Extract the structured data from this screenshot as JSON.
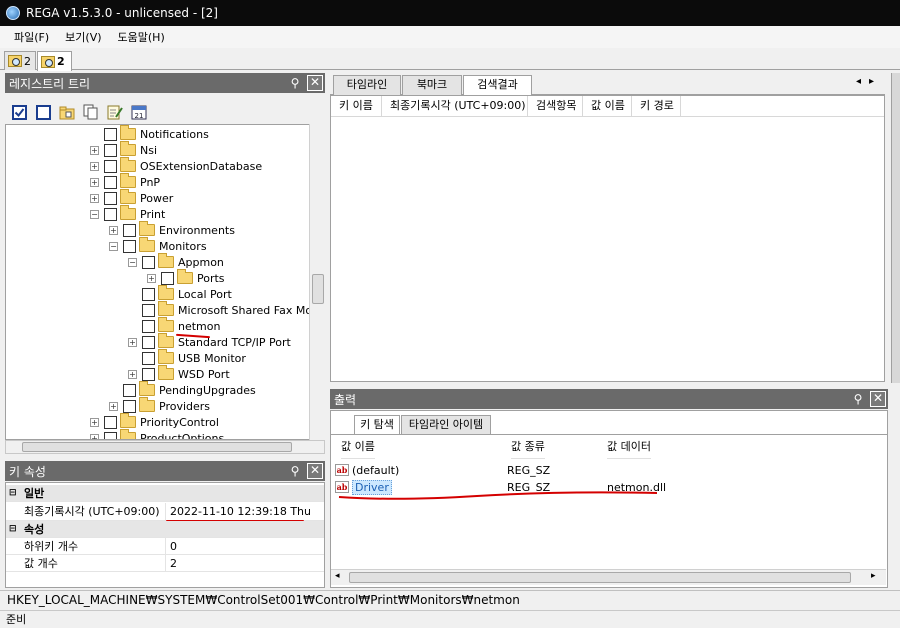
{
  "app": {
    "title": "REGA v1.5.3.0 - unlicensed - [2]"
  },
  "menu": {
    "file": "파일(F)",
    "view": "보기(V)",
    "help": "도움말(H)"
  },
  "doc_tabs": [
    {
      "label": "2"
    },
    {
      "label": "2"
    }
  ],
  "tree_panel": {
    "title": "레지스트리 트리"
  },
  "tree": {
    "items": [
      {
        "label": "Notifications"
      },
      {
        "label": "Nsi"
      },
      {
        "label": "OSExtensionDatabase"
      },
      {
        "label": "PnP"
      },
      {
        "label": "Power"
      },
      {
        "label": "Print"
      },
      {
        "label": "Environments"
      },
      {
        "label": "Monitors"
      },
      {
        "label": "Appmon"
      },
      {
        "label": "Ports"
      },
      {
        "label": "Local Port"
      },
      {
        "label": "Microsoft Shared Fax Monit"
      },
      {
        "label": "netmon"
      },
      {
        "label": "Standard TCP/IP Port"
      },
      {
        "label": "USB Monitor"
      },
      {
        "label": "WSD Port"
      },
      {
        "label": "PendingUpgrades"
      },
      {
        "label": "Providers"
      },
      {
        "label": "PriorityControl"
      },
      {
        "label": "ProductOptions"
      }
    ]
  },
  "props_panel": {
    "title": "키 속성",
    "general": "일반",
    "last_write_label": "최종기록시각 (UTC+09:00)",
    "last_write_value": "2022-11-10  12:39:18  Thu",
    "attributes": "속성",
    "subkey_label": "하위키 개수",
    "subkey_value": "0",
    "value_count_label": "값 개수",
    "value_count_value": "2"
  },
  "right_tabs": {
    "timeline": "타임라인",
    "bookmark": "북마크",
    "search": "검색결과"
  },
  "search_grid": {
    "columns": [
      "키 이름",
      "최종기록시각 (UTC+09:00)",
      "검색항목",
      "값 이름",
      "키 경로"
    ]
  },
  "output_panel": {
    "title": "출력",
    "tab_key_explore": "키 탐색",
    "tab_timeline_items": "타임라인 아이템",
    "col_name": "값 이름",
    "col_type": "값 종류",
    "col_data": "값 데이터",
    "rows": [
      {
        "name": "(default)",
        "type": "REG_SZ",
        "data": ""
      },
      {
        "name": "Driver",
        "type": "REG_SZ",
        "data": "netmon.dll"
      }
    ]
  },
  "path": "HKEY_LOCAL_MACHINE₩SYSTEM₩ControlSet001₩Control₩Print₩Monitors₩netmon",
  "status": "준비",
  "colors": {
    "title_bg": "#0b0b0b",
    "panel_header": "#6a6a6a",
    "annotation": "#d40000",
    "selection": "#cce8ff"
  }
}
